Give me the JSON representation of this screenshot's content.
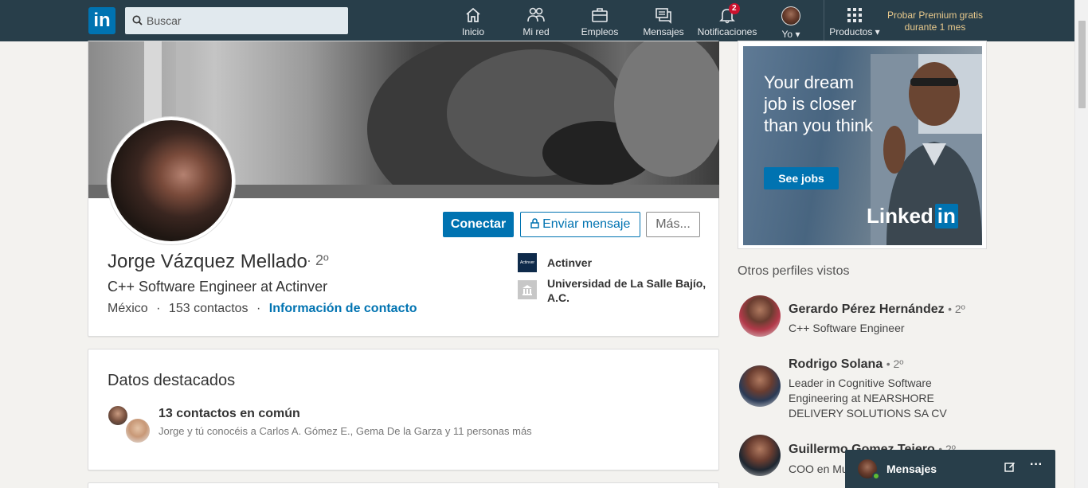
{
  "nav": {
    "logo": "in",
    "search_placeholder": "Buscar",
    "items": [
      {
        "label": "Inicio",
        "icon": "home-icon"
      },
      {
        "label": "Mi red",
        "icon": "network-icon"
      },
      {
        "label": "Empleos",
        "icon": "jobs-icon"
      },
      {
        "label": "Mensajes",
        "icon": "messaging-icon"
      },
      {
        "label": "Notificaciones",
        "icon": "bell-icon",
        "badge": "2"
      },
      {
        "label": "Yo",
        "icon": "avatar"
      },
      {
        "label": "Productos",
        "icon": "grid-icon"
      }
    ],
    "premium": "Probar Premium gratis durante 1 mes"
  },
  "profile": {
    "connect_label": "Conectar",
    "message_label": "Enviar mensaje",
    "more_label": "Más...",
    "name": "Jorge Vázquez Mellado",
    "degree": "· 2º",
    "headline": "C++ Software Engineer at Actinver",
    "location": "México",
    "separator": "·",
    "connections": "153 contactos",
    "contact_info": "Información de contacto",
    "company": "Actinver",
    "company_logo_text": "Actinver",
    "school": "Universidad de La Salle Bajío, A.C."
  },
  "highlights": {
    "title": "Datos destacados",
    "mutual_title": "13 contactos en común",
    "mutual_desc": "Jorge y tú conocéis a Carlos A. Gómez E., Gema De la Garza y 11 personas más"
  },
  "ad": {
    "headline": "Your dream job is closer than you think",
    "button": "See jobs",
    "brand": "Linked",
    "brand_in": "in"
  },
  "sidebar": {
    "title": "Otros perfiles vistos",
    "profiles": [
      {
        "name": "Gerardo Pérez Hernández",
        "degree": "• 2º",
        "headline": "C++ Software Engineer"
      },
      {
        "name": "Rodrigo Solana",
        "degree": "• 2º",
        "headline": "Leader in Cognitive Software Engineering at NEARSHORE DELIVERY SOLUTIONS SA CV"
      },
      {
        "name": "Guillermo Gomez Tejero",
        "degree": "• 2º",
        "headline": "COO en Mu"
      }
    ]
  },
  "messaging": {
    "title": "Mensajes",
    "compose_icon": "compose-icon",
    "more_icon": "more-icon"
  }
}
